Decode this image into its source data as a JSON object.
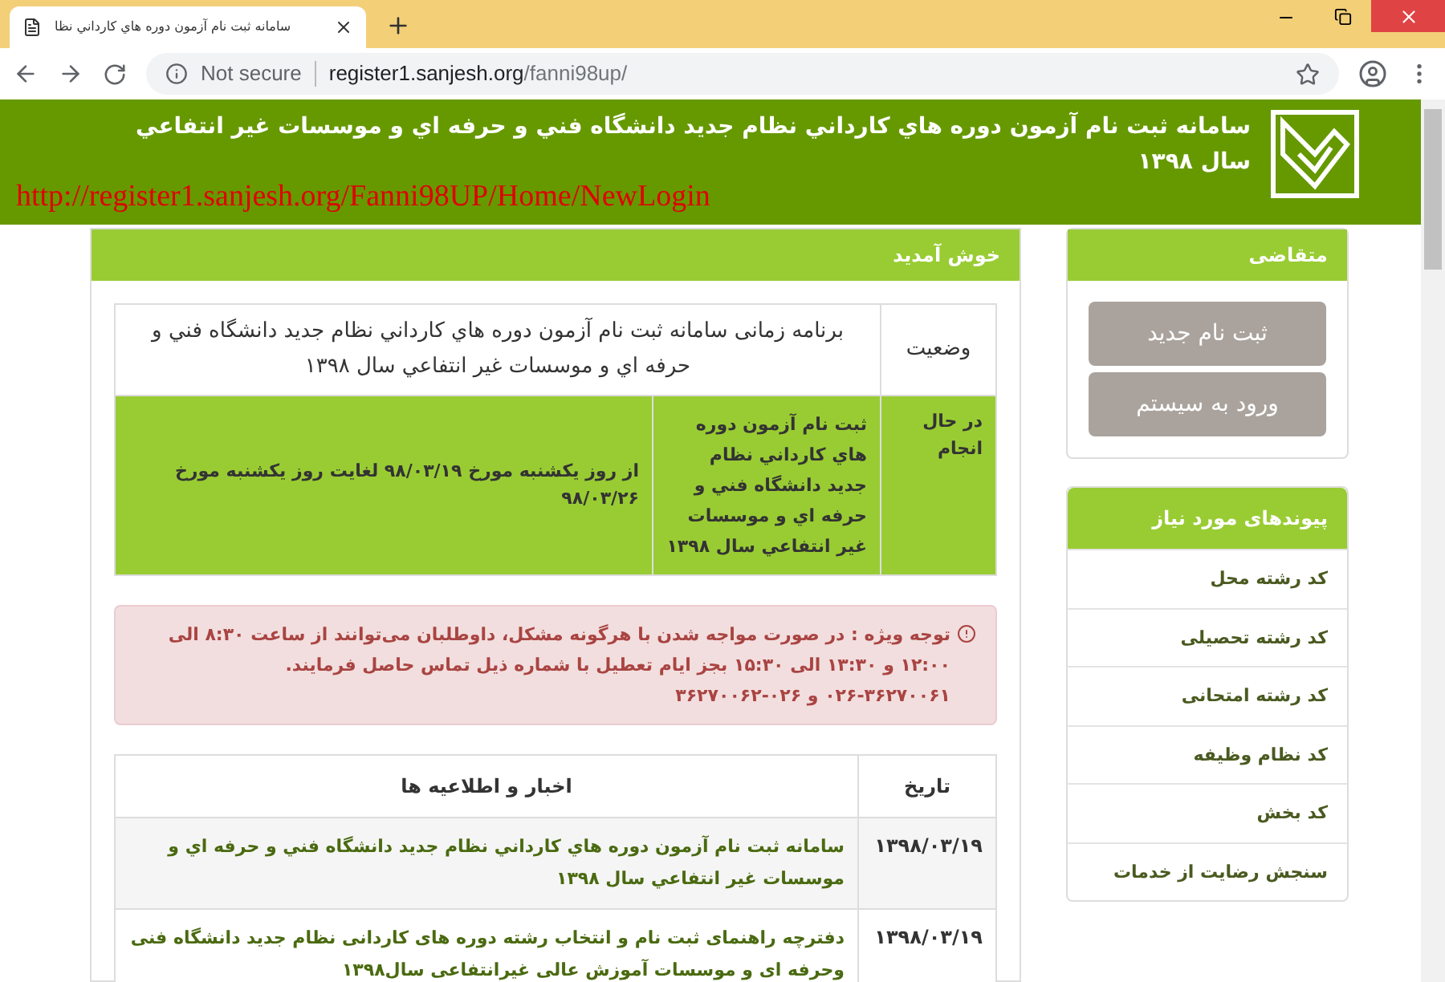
{
  "browser": {
    "tab_title": "سامانه ثبت نام آزمون دوره هاي كارداني نظا",
    "security": "Not secure",
    "url_host": "register1.sanjesh.org",
    "url_path": "/fanni98up/"
  },
  "header": {
    "title": "سامانه ثبت نام آزمون دوره هاي كارداني نظام جديد دانشگاه فني و حرفه اي و موسسات غير انتفاعي سال ۱۳۹۸",
    "overlay_url": "http://register1.sanjesh.org/Fanni98UP/Home/NewLogin"
  },
  "welcome": {
    "title": "خوش آمدید",
    "schedule": {
      "columns": [
        "وضعیت",
        "برنامه زمانی سامانه ثبت نام آزمون دوره هاي كارداني نظام جديد دانشگاه فني و حرفه اي و موسسات غير انتفاعي سال ۱۳۹۸"
      ],
      "rows": [
        {
          "status": "در حال انجام",
          "stage": "ثبت نام آزمون دوره هاي كارداني نظام جديد دانشگاه فني و حرفه اي و موسسات غير انتفاعي سال ۱۳۹۸",
          "period": "از روز یکشنبه مورخ ۹۸/۰۳/۱۹ لغایت روز یکشنبه مورخ ۹۸/۰۳/۲۶",
          "current": true
        }
      ]
    },
    "notice": {
      "text": "توجه ویژه : در صورت مواجه شدن با هرگونه مشکل، داوطلبان می‌توانند از ساعت ۸:۳۰ الی ۱۲:۰۰ و ۱۳:۳۰ الی ۱۵:۳۰ بجز ایام تعطیل با شماره ذیل تماس حاصل فرمایند.",
      "phones": "۰۲۶-۳۶۲۷۰۰۶۱ و ۰۲۶-۳۶۲۷۰۰۶۲"
    },
    "news": {
      "columns": [
        "تاریخ",
        "اخبار و اطلاعیه ها"
      ],
      "rows": [
        {
          "date": "۱۳۹۸/۰۳/۱۹",
          "title": "سامانه ثبت نام آزمون دوره هاي كارداني نظام جديد دانشگاه فني و حرفه اي و موسسات غير انتفاعي سال ۱۳۹۸"
        },
        {
          "date": "۱۳۹۸/۰۳/۱۹",
          "title": "دفترچه راهنمای ثبت نام و انتخاب رشته دوره های کاردانی نظام جدید دانشگاه فنی وحرفه ای و موسسات آموزش عالی غیرانتفاعی سال۱۳۹۸"
        }
      ]
    }
  },
  "applicant": {
    "title": "متقاضی",
    "buttons": [
      "ثبت نام جدید",
      "ورود به سیستم"
    ]
  },
  "links": {
    "title": "پیوندهای مورد نیاز",
    "items": [
      "کد رشته محل",
      "کد رشته تحصیلی",
      "کد رشته امتحانی",
      "کد نظام وظیفه",
      "کد بخش",
      "سنجش رضایت از خدمات"
    ]
  }
}
